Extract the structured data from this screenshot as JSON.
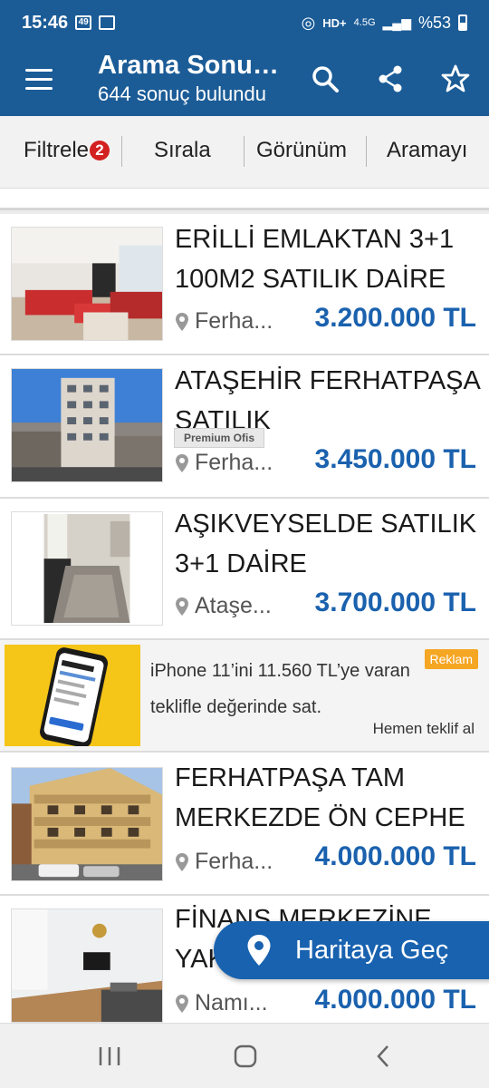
{
  "status": {
    "time": "15:46",
    "battery": "%53",
    "network": "4.5G"
  },
  "header": {
    "title": "Arama Sonuçları",
    "subtitle": "644 sonuç bulundu"
  },
  "toolbar": {
    "filter_label": "Filtrele",
    "filter_count": "2",
    "sort_label": "Sırala",
    "view_label": "Görünüm",
    "save_search_label": "Aramayı"
  },
  "listings": [
    {
      "title": "ERİLLİ EMLAKTAN 3+1 100M2 SATILIK DAİRE",
      "location": "Ferha...",
      "price": "3.200.000 TL",
      "premium": ""
    },
    {
      "title": "ATAŞEHİR FERHATPAŞA SATILIK",
      "location": "Ferha...",
      "price": "3.450.000 TL",
      "premium": "Premium Ofis"
    },
    {
      "title": "AŞIKVEYSELDE SATILIK 3+1 DAİRE",
      "location": "Ataşe...",
      "price": "3.700.000 TL",
      "premium": ""
    },
    {
      "title": "FERHATPAŞA TAM MERKEZDE ÖN CEPHE",
      "location": "Ferha...",
      "price": "4.000.000 TL",
      "premium": ""
    },
    {
      "title": "FİNANS MERKEZİNE YAKIN",
      "location": "Namı...",
      "price": "4.000.000 TL",
      "premium": ""
    }
  ],
  "ad": {
    "text": "iPhone 11’ini 11.560 TL’ye varan teklifle değerinde sat.",
    "badge": "Reklam",
    "cta": "Hemen teklif al"
  },
  "fab": {
    "label": "Haritaya Geç"
  },
  "colors": {
    "primary": "#1b5c97",
    "price": "#1a61ae",
    "badge": "#d32020",
    "ad_badge": "#f5a623"
  }
}
